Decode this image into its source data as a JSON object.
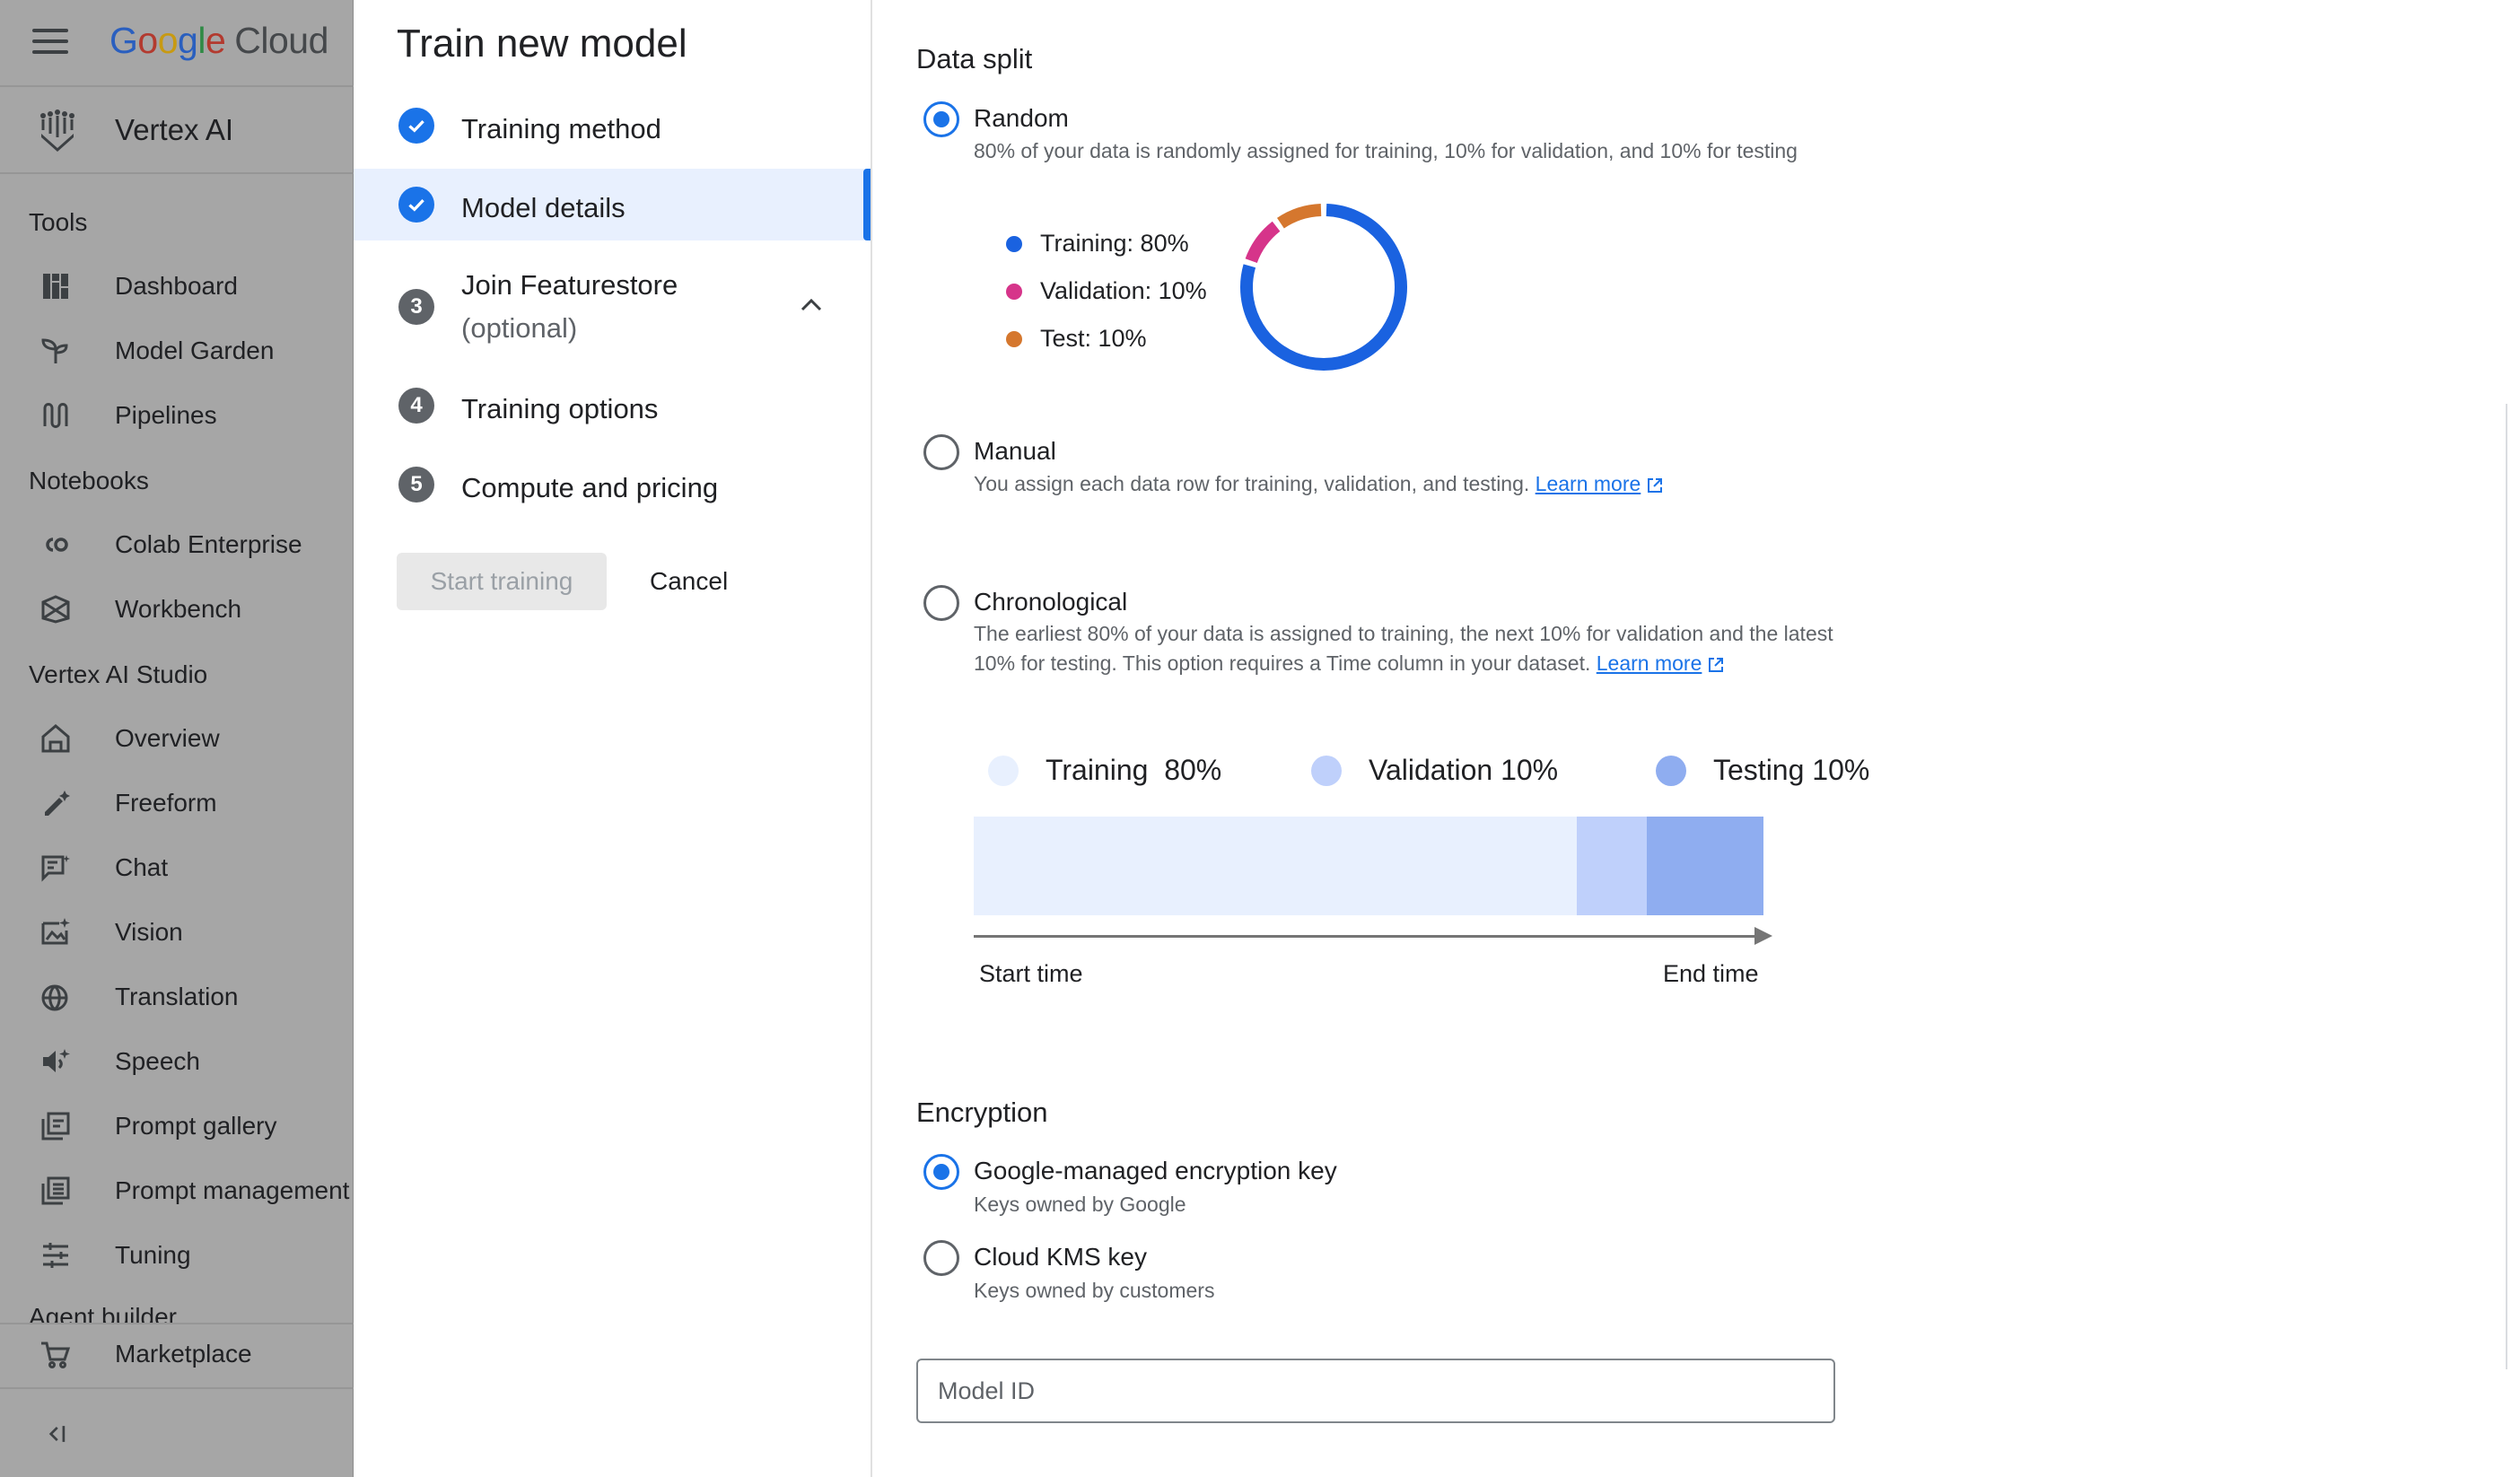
{
  "header": {
    "logo_google": "Google",
    "logo_cloud": "Cloud",
    "product_name": "Vertex AI"
  },
  "sidebar": {
    "sections": [
      {
        "title": "Tools"
      },
      {
        "title": "Notebooks"
      },
      {
        "title": "Vertex AI Studio"
      },
      {
        "title": "Agent builder"
      }
    ],
    "items": [
      {
        "label": "Dashboard",
        "icon": "dashboard-icon"
      },
      {
        "label": "Model Garden",
        "icon": "sprout-icon"
      },
      {
        "label": "Pipelines",
        "icon": "pipeline-icon"
      },
      {
        "label": "Colab Enterprise",
        "icon": "colab-icon"
      },
      {
        "label": "Workbench",
        "icon": "workbench-icon"
      },
      {
        "label": "Overview",
        "icon": "home-icon"
      },
      {
        "label": "Freeform",
        "icon": "edit-sparkle-icon"
      },
      {
        "label": "Chat",
        "icon": "chat-icon"
      },
      {
        "label": "Vision",
        "icon": "image-sparkle-icon"
      },
      {
        "label": "Translation",
        "icon": "translate-icon"
      },
      {
        "label": "Speech",
        "icon": "speaker-sparkle-icon"
      },
      {
        "label": "Prompt gallery",
        "icon": "gallery-icon"
      },
      {
        "label": "Prompt management",
        "icon": "list-icon"
      },
      {
        "label": "Tuning",
        "icon": "tune-icon"
      }
    ],
    "marketplace": "Marketplace",
    "collapse_icon": "collapse-left-icon"
  },
  "stepper": {
    "title": "Train new model",
    "steps": [
      {
        "label": "Training method",
        "state": "done"
      },
      {
        "label": "Model details",
        "state": "done"
      },
      {
        "number": "3",
        "label": "Join Featurestore",
        "sublabel": "(optional)"
      },
      {
        "number": "4",
        "label": "Training options"
      },
      {
        "number": "5",
        "label": "Compute and pricing"
      }
    ],
    "start_label": "Start training",
    "cancel_label": "Cancel"
  },
  "data_split": {
    "title": "Data split",
    "random": {
      "title": "Random",
      "description": "80% of your data is randomly assigned for training, 10% for validation, and 10% for testing",
      "legend": [
        "Training: 80%",
        "Validation: 10%",
        "Test: 10%"
      ],
      "selected": true
    },
    "manual": {
      "title": "Manual",
      "description": "You assign each data row for training, validation, and testing.",
      "link": "Learn more"
    },
    "chronological": {
      "title": "Chronological",
      "description_line1": "The earliest 80% of your data is assigned to training, the next 10% for validation and the latest",
      "description_line2": "10% for testing. This option requires a Time column in your dataset.",
      "link": "Learn more"
    },
    "timeline": {
      "legend": [
        "Training  80%",
        "Validation 10%",
        "Testing 10%"
      ],
      "start_label": "Start time",
      "end_label": "End time"
    }
  },
  "split_values": {
    "training": 80,
    "validation": 10,
    "test": 10
  },
  "colors": {
    "training": "#1a62e0",
    "validation": "#d6348a",
    "test": "#d5772e",
    "tl_training": "#e8f0fe",
    "tl_validation": "#bfd0fb",
    "tl_testing": "#8fadf0",
    "accent": "#1a73e8"
  },
  "encryption": {
    "title": "Encryption",
    "google_managed": {
      "title": "Google-managed encryption key",
      "description": "Keys owned by Google",
      "selected": true
    },
    "cloud_kms": {
      "title": "Cloud KMS key",
      "description": "Keys owned by customers"
    }
  },
  "model_id": {
    "placeholder": "Model ID",
    "value": ""
  }
}
